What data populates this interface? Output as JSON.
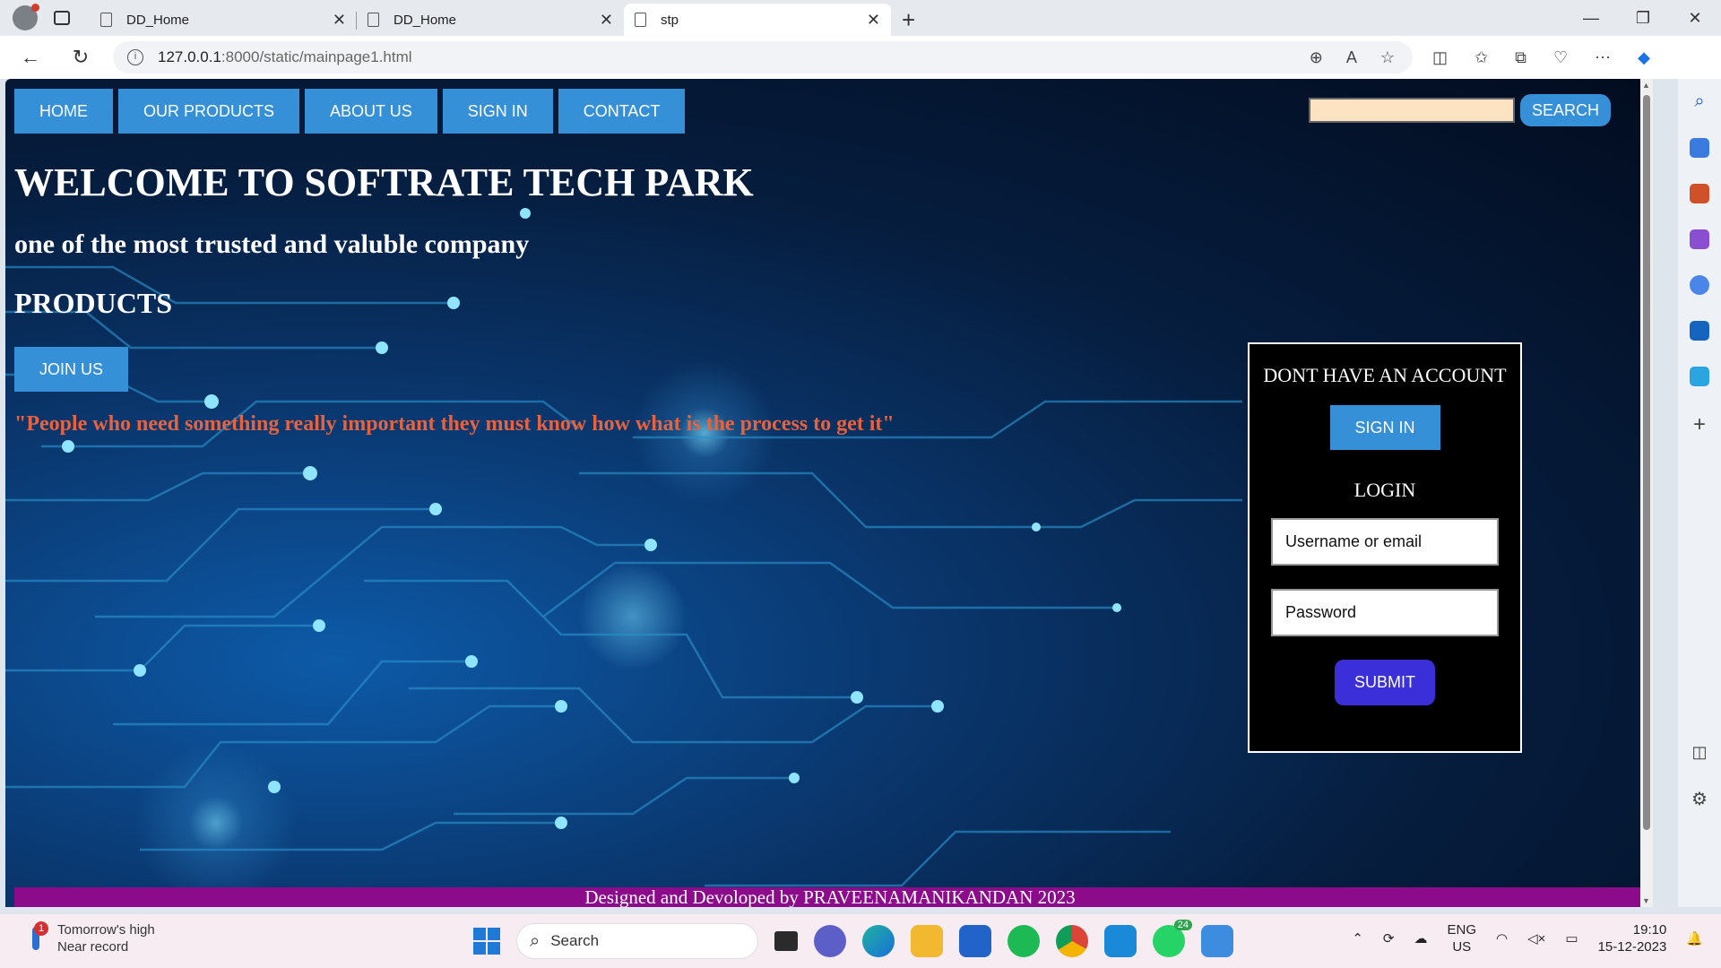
{
  "browser": {
    "tabs": [
      {
        "title": "DD_Home",
        "active": false
      },
      {
        "title": "DD_Home",
        "active": false
      },
      {
        "title": "stp",
        "active": true
      }
    ],
    "url_host": "127.0.0.1",
    "url_path": ":8000/static/mainpage1.html"
  },
  "page": {
    "menu": [
      "HOME",
      "OUR PRODUCTS",
      "ABOUT US",
      "SIGN IN",
      "CONTACT"
    ],
    "search": {
      "button": "SEARCH",
      "value": ""
    },
    "welcome": "WELCOME TO SOFTRATE TECH PARK",
    "tagline": "one of the most trusted and valuble company",
    "products": "PRODUCTS",
    "join_button": "JOIN US",
    "quote": "\"People who need something really important they must know how what is the process to get it\"",
    "login_box": {
      "no_account": "DONT HAVE AN ACCOUNT",
      "signin_button": "SIGN IN",
      "login_heading": "LOGIN",
      "username_placeholder": "Username or email",
      "password_placeholder": "Password",
      "submit_button": "SUBMIT"
    },
    "footer": "Designed and Devoloped by PRAVEENAMANIKANDAN 2023",
    "colors": {
      "button": "#3590d8",
      "submit": "#3b2fd9",
      "footer": "#8b0b8b",
      "quote": "#e8633d",
      "search_field": "#fde3c2"
    }
  },
  "taskbar": {
    "weather_line1": "Tomorrow's high",
    "weather_line2": "Near record",
    "weather_badge": "1",
    "search": "Search",
    "whatsapp_badge": "24",
    "lang1": "ENG",
    "lang2": "US",
    "time": "19:10",
    "date": "15-12-2023"
  }
}
